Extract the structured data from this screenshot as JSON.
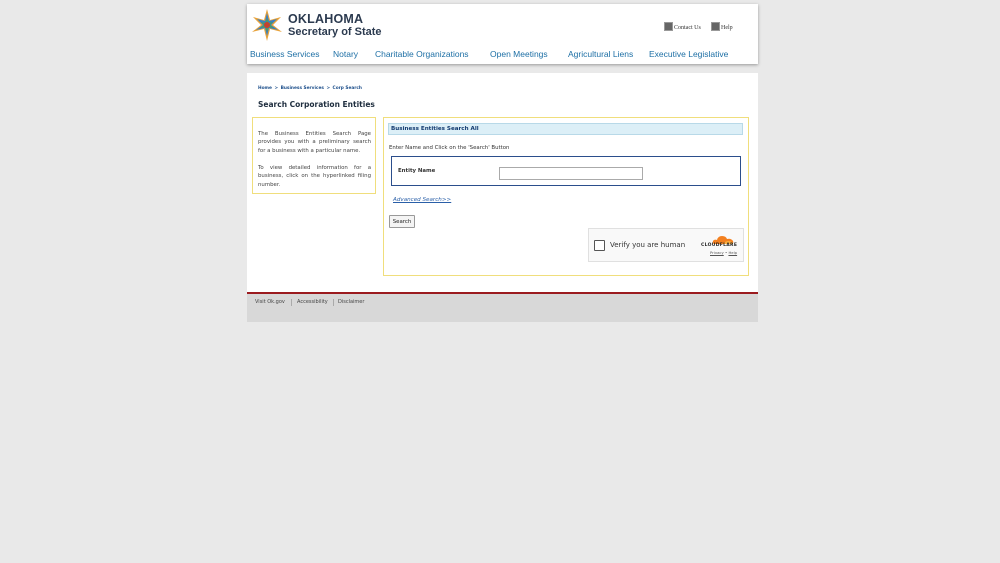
{
  "header": {
    "logo": {
      "line1": "OKLAHOMA",
      "line2": "Secretary of State"
    },
    "contact_us": "Contact Us",
    "help": "Help"
  },
  "nav": [
    {
      "label": "Business Services"
    },
    {
      "label": "Notary"
    },
    {
      "label": "Charitable Organizations"
    },
    {
      "label": "Open Meetings"
    },
    {
      "label": "Agricultural Liens"
    },
    {
      "label": "Executive Legislative"
    }
  ],
  "breadcrumb": {
    "home": "Home",
    "sep": ">",
    "business_services": "Business Services",
    "current": "Corp Search"
  },
  "page_title": "Search Corporation Entities",
  "info": {
    "p1": "The Business Entities Search Page provides you with a preliminary search for a business with a particular name.",
    "p2": "To view detailed information for a business, click on the hyperlinked filing number."
  },
  "search": {
    "header": "Business Entities Search All",
    "instructions": "Enter Name and Click on the 'Search' Button",
    "entity_label": "Entity Name",
    "entity_value": "",
    "advanced_link": "Advanced Search>>",
    "search_button": "Search"
  },
  "captcha": {
    "text": "Verify you are human",
    "brand": "CLOUDFLARE",
    "privacy": "Privacy",
    "dot": "•",
    "help": "Help"
  },
  "footer": {
    "links": [
      "Visit Ok.gov",
      "Accessibility",
      "Disclaimer"
    ]
  },
  "colors": {
    "nav_link": "#1d6fa5",
    "footer_accent": "#9b1b1f",
    "panel_border": "#f0de7c",
    "search_header_bg": "#dceff7"
  }
}
